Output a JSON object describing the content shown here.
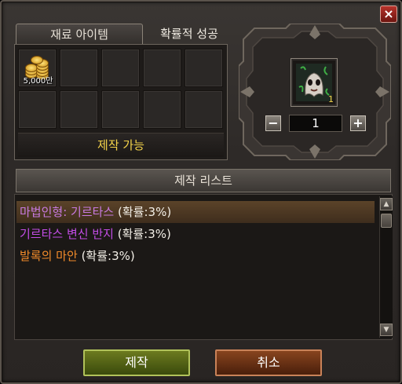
{
  "window": {
    "close_label": "×"
  },
  "tabs": [
    {
      "label": "재료 아이템",
      "active": true
    },
    {
      "label": "확률적 성공",
      "active": false
    }
  ],
  "materials": {
    "slots": [
      {
        "icon": "gold-coins-icon",
        "label": "5,000만"
      },
      {
        "icon": "",
        "label": ""
      },
      {
        "icon": "",
        "label": ""
      },
      {
        "icon": "",
        "label": ""
      },
      {
        "icon": "",
        "label": ""
      },
      {
        "icon": "",
        "label": ""
      },
      {
        "icon": "",
        "label": ""
      },
      {
        "icon": "",
        "label": ""
      },
      {
        "icon": "",
        "label": ""
      },
      {
        "icon": "",
        "label": ""
      }
    ],
    "status": "제작 가능"
  },
  "result": {
    "icon": "ghost-doll-icon",
    "count": "1",
    "quantity": "1",
    "minus_label": "−",
    "plus_label": "+"
  },
  "craft_list": {
    "title": "제작 리스트",
    "items": [
      {
        "name": "마법인형: 기르타스",
        "rate": "(확률:3%)",
        "color": "#c77ae0",
        "selected": true
      },
      {
        "name": "기르타스 변신 반지",
        "rate": "(확률:3%)",
        "color": "#c34de6",
        "selected": false
      },
      {
        "name": "발록의 마안",
        "rate": "(확률:3%)",
        "color": "#f08a2a",
        "selected": false
      }
    ],
    "scroll_up": "▲",
    "scroll_down": "▼"
  },
  "buttons": {
    "craft": "제작",
    "cancel": "취소"
  },
  "colors": {
    "status": "#f4d34a",
    "accent_ok": "#6c7a1f",
    "accent_cancel": "#87441e"
  }
}
